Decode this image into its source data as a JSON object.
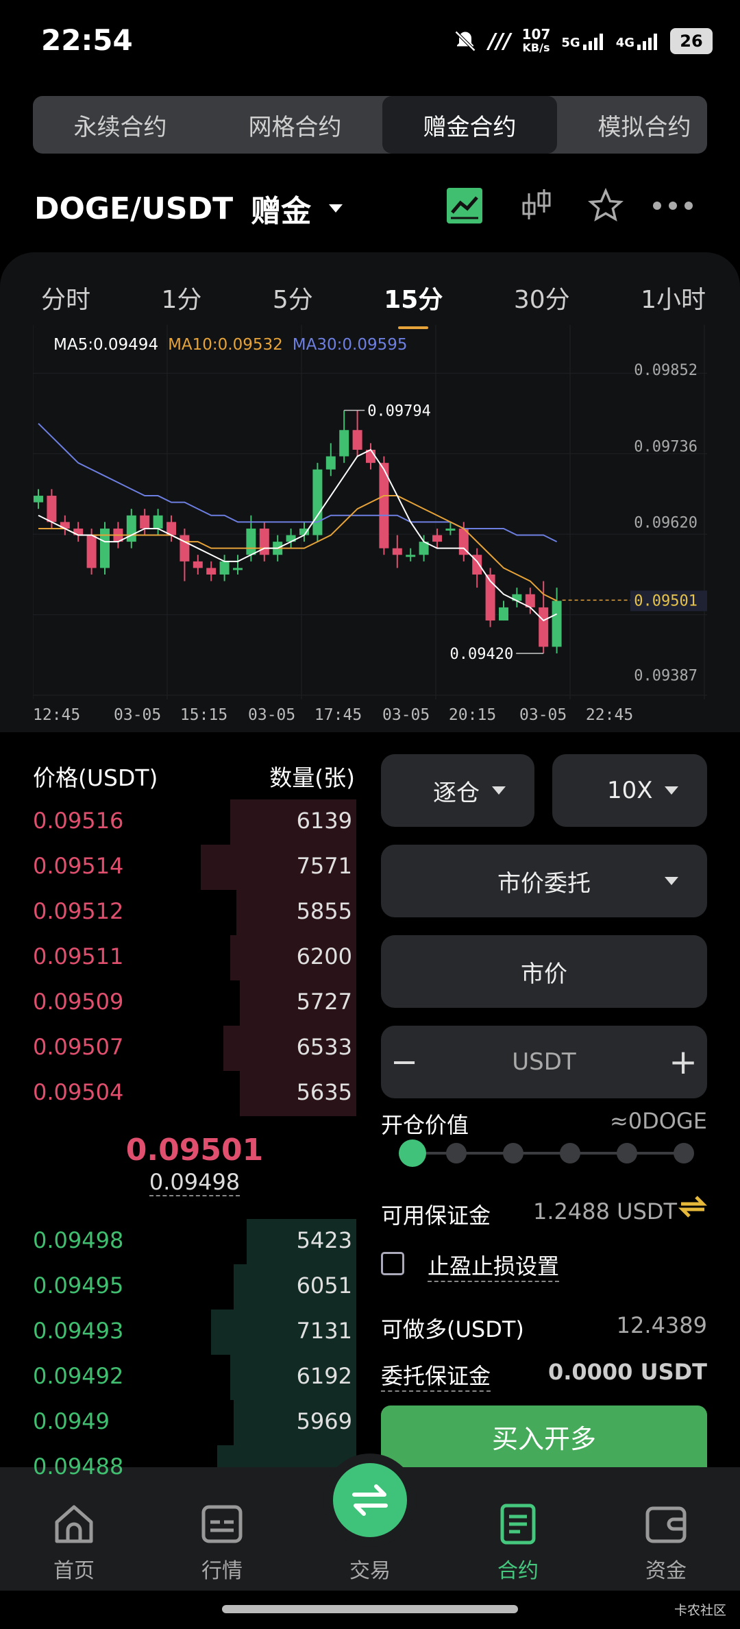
{
  "status_bar": {
    "time": "22:54",
    "net_speed": "107",
    "net_unit": "KB/s",
    "net1": "5G",
    "net2": "4G",
    "battery": "26"
  },
  "contract_tabs": [
    "永续合约",
    "网格合约",
    "赠金合约",
    "模拟合约"
  ],
  "active_contract_tab": 2,
  "pair": {
    "symbol": "DOGE/USDT",
    "badge": "赠金"
  },
  "time_tabs": [
    "分时",
    "1分",
    "5分",
    "15分",
    "30分",
    "1小时"
  ],
  "active_time_tab": 3,
  "ma": {
    "ma5": "MA5:0.09494",
    "ma10": "MA10:0.09532",
    "ma30": "MA30:0.09595"
  },
  "colors": {
    "up": "#3fbf6f",
    "down": "#e0506e",
    "ma5": "#ffffff",
    "ma10": "#e6a33a",
    "ma30": "#6d7fe0",
    "accent": "#45c77e"
  },
  "chart_data": {
    "type": "candlestick",
    "y_ticks": [
      "0.09852",
      "0.09736",
      "0.09620",
      "0.09501",
      "0.09387"
    ],
    "ylim": [
      0.0935,
      0.0992
    ],
    "x_labels": [
      "12:45",
      "03-05  15:15",
      "03-05  17:45",
      "03-05  20:15",
      "03-05  22:45"
    ],
    "high_label": "0.09794",
    "low_label": "0.09420",
    "last_price": "0.09501",
    "candles": [
      [
        0.0965,
        0.0966,
        0.0967,
        0.0964
      ],
      [
        0.0966,
        0.0962,
        0.0967,
        0.0961
      ],
      [
        0.0962,
        0.0961,
        0.0963,
        0.096
      ],
      [
        0.0961,
        0.096,
        0.0962,
        0.0959
      ],
      [
        0.096,
        0.0955,
        0.0961,
        0.0954
      ],
      [
        0.0955,
        0.0961,
        0.0962,
        0.0954
      ],
      [
        0.0961,
        0.0959,
        0.0962,
        0.0958
      ],
      [
        0.0959,
        0.0963,
        0.0964,
        0.0958
      ],
      [
        0.0963,
        0.0961,
        0.0964,
        0.096
      ],
      [
        0.0961,
        0.0963,
        0.0964,
        0.096
      ],
      [
        0.0962,
        0.096,
        0.0963,
        0.0959
      ],
      [
        0.096,
        0.0956,
        0.0961,
        0.0953
      ],
      [
        0.0956,
        0.0955,
        0.0957,
        0.0954
      ],
      [
        0.0955,
        0.0954,
        0.0956,
        0.0953
      ],
      [
        0.0954,
        0.0956,
        0.0957,
        0.0953
      ],
      [
        0.0955,
        0.0955,
        0.0957,
        0.0954
      ],
      [
        0.0957,
        0.0961,
        0.0963,
        0.0956
      ],
      [
        0.0961,
        0.0957,
        0.0962,
        0.0956
      ],
      [
        0.0957,
        0.0959,
        0.096,
        0.0956
      ],
      [
        0.0959,
        0.096,
        0.0961,
        0.0958
      ],
      [
        0.096,
        0.0961,
        0.0962,
        0.0959
      ],
      [
        0.096,
        0.097,
        0.0971,
        0.0959
      ],
      [
        0.097,
        0.0972,
        0.0974,
        0.0969
      ],
      [
        0.0972,
        0.0976,
        0.0979,
        0.0971
      ],
      [
        0.0976,
        0.0973,
        0.0979,
        0.0972
      ],
      [
        0.0973,
        0.0971,
        0.0974,
        0.097
      ],
      [
        0.0971,
        0.0958,
        0.0972,
        0.0957
      ],
      [
        0.0958,
        0.0957,
        0.096,
        0.0955
      ],
      [
        0.0957,
        0.0957,
        0.0958,
        0.0956
      ],
      [
        0.0957,
        0.0959,
        0.096,
        0.0956
      ],
      [
        0.096,
        0.0959,
        0.0961,
        0.0958
      ],
      [
        0.0961,
        0.0961,
        0.0962,
        0.096
      ],
      [
        0.0961,
        0.0957,
        0.0962,
        0.0956
      ],
      [
        0.0957,
        0.0954,
        0.0958,
        0.0952
      ],
      [
        0.0954,
        0.0947,
        0.0955,
        0.0946
      ],
      [
        0.0947,
        0.0949,
        0.095,
        0.0947
      ],
      [
        0.095,
        0.0951,
        0.0952,
        0.0949
      ],
      [
        0.0951,
        0.0949,
        0.0952,
        0.0948
      ],
      [
        0.0949,
        0.0943,
        0.0953,
        0.0942
      ],
      [
        0.0943,
        0.095,
        0.0952,
        0.0942
      ]
    ],
    "ma5": [
      0.0963,
      0.0962,
      0.0961,
      0.096,
      0.096,
      0.0959,
      0.0959,
      0.096,
      0.0961,
      0.0961,
      0.096,
      0.0959,
      0.0958,
      0.0957,
      0.0956,
      0.0956,
      0.0957,
      0.0958,
      0.0958,
      0.0959,
      0.096,
      0.0963,
      0.0966,
      0.0969,
      0.0972,
      0.0973,
      0.097,
      0.0966,
      0.0962,
      0.0959,
      0.0958,
      0.0958,
      0.0958,
      0.0956,
      0.0953,
      0.0951,
      0.095,
      0.0949,
      0.0947,
      0.0948
    ],
    "ma10": [
      0.0961,
      0.0961,
      0.0961,
      0.096,
      0.096,
      0.096,
      0.096,
      0.096,
      0.096,
      0.096,
      0.096,
      0.0959,
      0.0959,
      0.0958,
      0.0958,
      0.0958,
      0.0958,
      0.0958,
      0.0958,
      0.0958,
      0.0958,
      0.0959,
      0.096,
      0.0962,
      0.0964,
      0.0965,
      0.0966,
      0.0966,
      0.0965,
      0.0964,
      0.0963,
      0.0962,
      0.0961,
      0.0959,
      0.0957,
      0.0955,
      0.0954,
      0.0953,
      0.0951,
      0.095
    ],
    "ma30": [
      0.0977,
      0.0975,
      0.0973,
      0.0971,
      0.097,
      0.0969,
      0.0968,
      0.0967,
      0.0966,
      0.0966,
      0.0965,
      0.0965,
      0.0964,
      0.0963,
      0.0963,
      0.0962,
      0.0962,
      0.0962,
      0.0962,
      0.0962,
      0.0962,
      0.0962,
      0.0963,
      0.0963,
      0.0963,
      0.0963,
      0.0963,
      0.0963,
      0.0962,
      0.0962,
      0.0962,
      0.0962,
      0.0961,
      0.0961,
      0.0961,
      0.0961,
      0.096,
      0.096,
      0.096,
      0.0959
    ]
  },
  "orderbook": {
    "price_header": "价格(USDT)",
    "qty_header": "数量(张)",
    "asks": [
      {
        "price": "0.09516",
        "qty": "6139",
        "depth": 0.39
      },
      {
        "price": "0.09514",
        "qty": "7571",
        "depth": 0.48
      },
      {
        "price": "0.09512",
        "qty": "5855",
        "depth": 0.37
      },
      {
        "price": "0.09511",
        "qty": "6200",
        "depth": 0.39
      },
      {
        "price": "0.09509",
        "qty": "5727",
        "depth": 0.36
      },
      {
        "price": "0.09507",
        "qty": "6533",
        "depth": 0.41
      },
      {
        "price": "0.09504",
        "qty": "5635",
        "depth": 0.36
      }
    ],
    "mid_price": "0.09501",
    "mark_price": "0.09498",
    "bids": [
      {
        "price": "0.09498",
        "qty": "5423",
        "depth": 0.34
      },
      {
        "price": "0.09495",
        "qty": "6051",
        "depth": 0.38
      },
      {
        "price": "0.09493",
        "qty": "7131",
        "depth": 0.45
      },
      {
        "price": "0.09492",
        "qty": "6192",
        "depth": 0.39
      },
      {
        "price": "0.0949",
        "qty": "5969",
        "depth": 0.38
      },
      {
        "price": "0.09488",
        "qty": "",
        "depth": 0.43
      }
    ]
  },
  "form": {
    "margin_mode": "逐仓",
    "leverage": "10X",
    "order_type": "市价委托",
    "price_field": "市价",
    "amount_unit": "USDT",
    "minus": "−",
    "plus": "+",
    "open_value_label": "开仓价值",
    "open_value": "≈0DOGE",
    "slider_percent": 0,
    "available_label": "可用保证金",
    "available_value": "1.2488 USDT",
    "tpsl_label": "止盈止损设置",
    "long_label": "可做多(USDT)",
    "long_value": "12.4389",
    "margin_label": "委托保证金",
    "margin_value": "0.0000 USDT",
    "buy_label": "买入开多"
  },
  "nav": [
    {
      "label": "首页",
      "icon": "home-icon"
    },
    {
      "label": "行情",
      "icon": "market-icon"
    },
    {
      "label": "交易",
      "icon": "swap-icon"
    },
    {
      "label": "合约",
      "icon": "contract-icon"
    },
    {
      "label": "资金",
      "icon": "wallet-icon"
    }
  ],
  "active_nav": 3,
  "watermark": "卡农社区"
}
